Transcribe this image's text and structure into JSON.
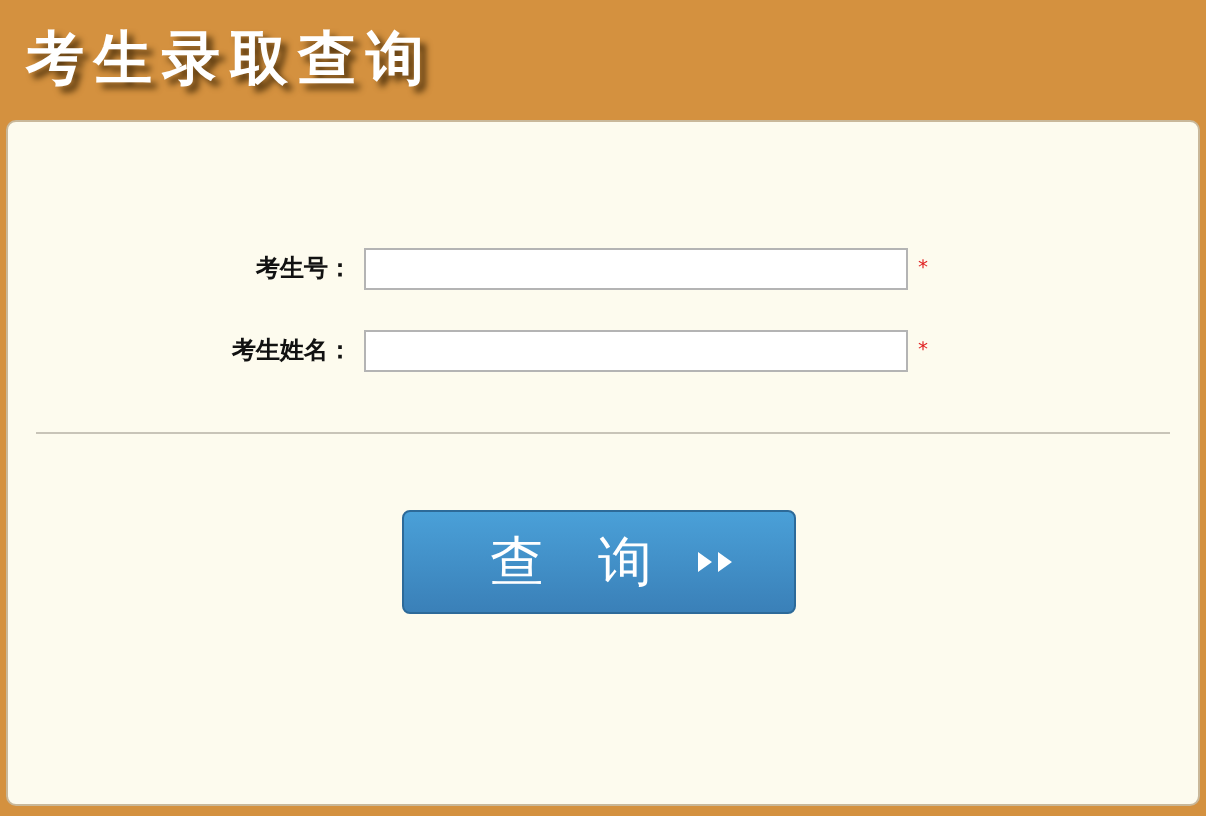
{
  "header": {
    "title": "考生录取查询"
  },
  "fields": [
    {
      "label": "考生号：",
      "required_mark": "*"
    },
    {
      "label": "考生姓名：",
      "required_mark": "*"
    }
  ],
  "submit_button": {
    "label": "查　询"
  }
}
